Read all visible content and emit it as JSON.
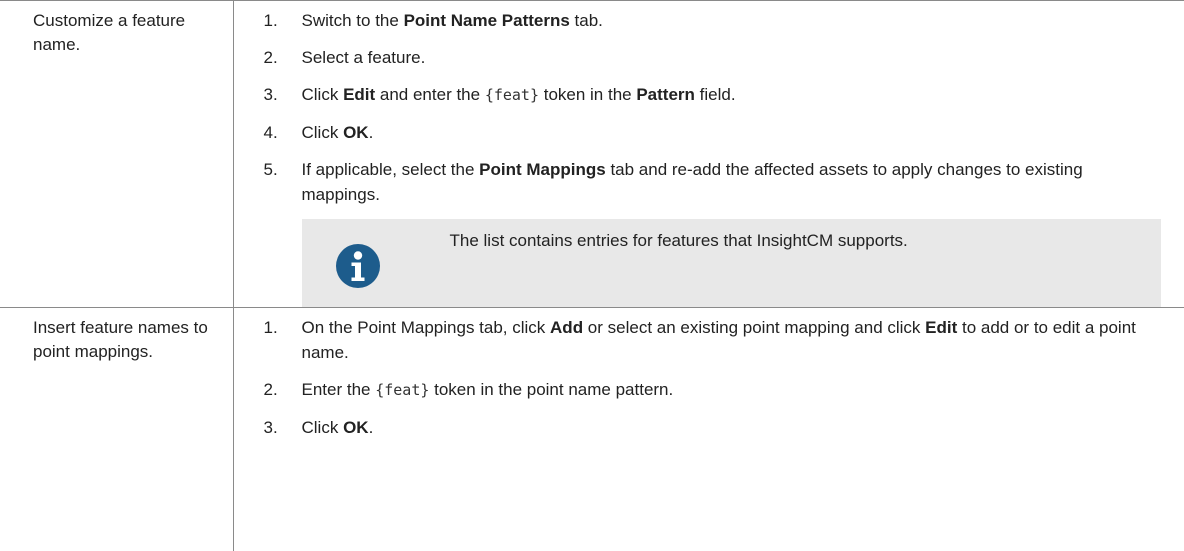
{
  "rows": [
    {
      "task": "Customize a feature name.",
      "steps": [
        {
          "num": "1.",
          "parts": [
            "Switch to the ",
            "Point Name Patterns",
            " tab."
          ]
        },
        {
          "num": "2.",
          "parts": [
            "Select a feature."
          ]
        },
        {
          "num": "3.",
          "parts": [
            "Click ",
            "Edit",
            " and enter the ",
            "{feat}",
            " token in the ",
            "Pattern",
            " field."
          ]
        },
        {
          "num": "4.",
          "parts": [
            "Click ",
            "OK",
            "."
          ]
        },
        {
          "num": "5.",
          "parts": [
            "If applicable, select the ",
            "Point Mappings",
            " tab and re-add the affected assets to apply changes to existing mappings."
          ]
        }
      ],
      "note": {
        "icon": "info-icon",
        "text": "The list contains entries for features that InsightCM supports."
      }
    },
    {
      "task": "Insert feature names to point mappings.",
      "steps": [
        {
          "num": "1.",
          "parts": [
            "On the Point Mappings tab, click ",
            "Add",
            " or select an existing point mapping and click ",
            "Edit",
            " to add or to edit a point name."
          ]
        },
        {
          "num": "2.",
          "parts": [
            "Enter the ",
            "{feat}",
            " token in the point name pattern."
          ]
        },
        {
          "num": "3.",
          "parts": [
            "Click ",
            "OK",
            "."
          ]
        }
      ]
    }
  ],
  "colors": {
    "border": "#8a8a8a",
    "note_bg": "#e8e8e8",
    "icon": "#1d5c8c"
  }
}
